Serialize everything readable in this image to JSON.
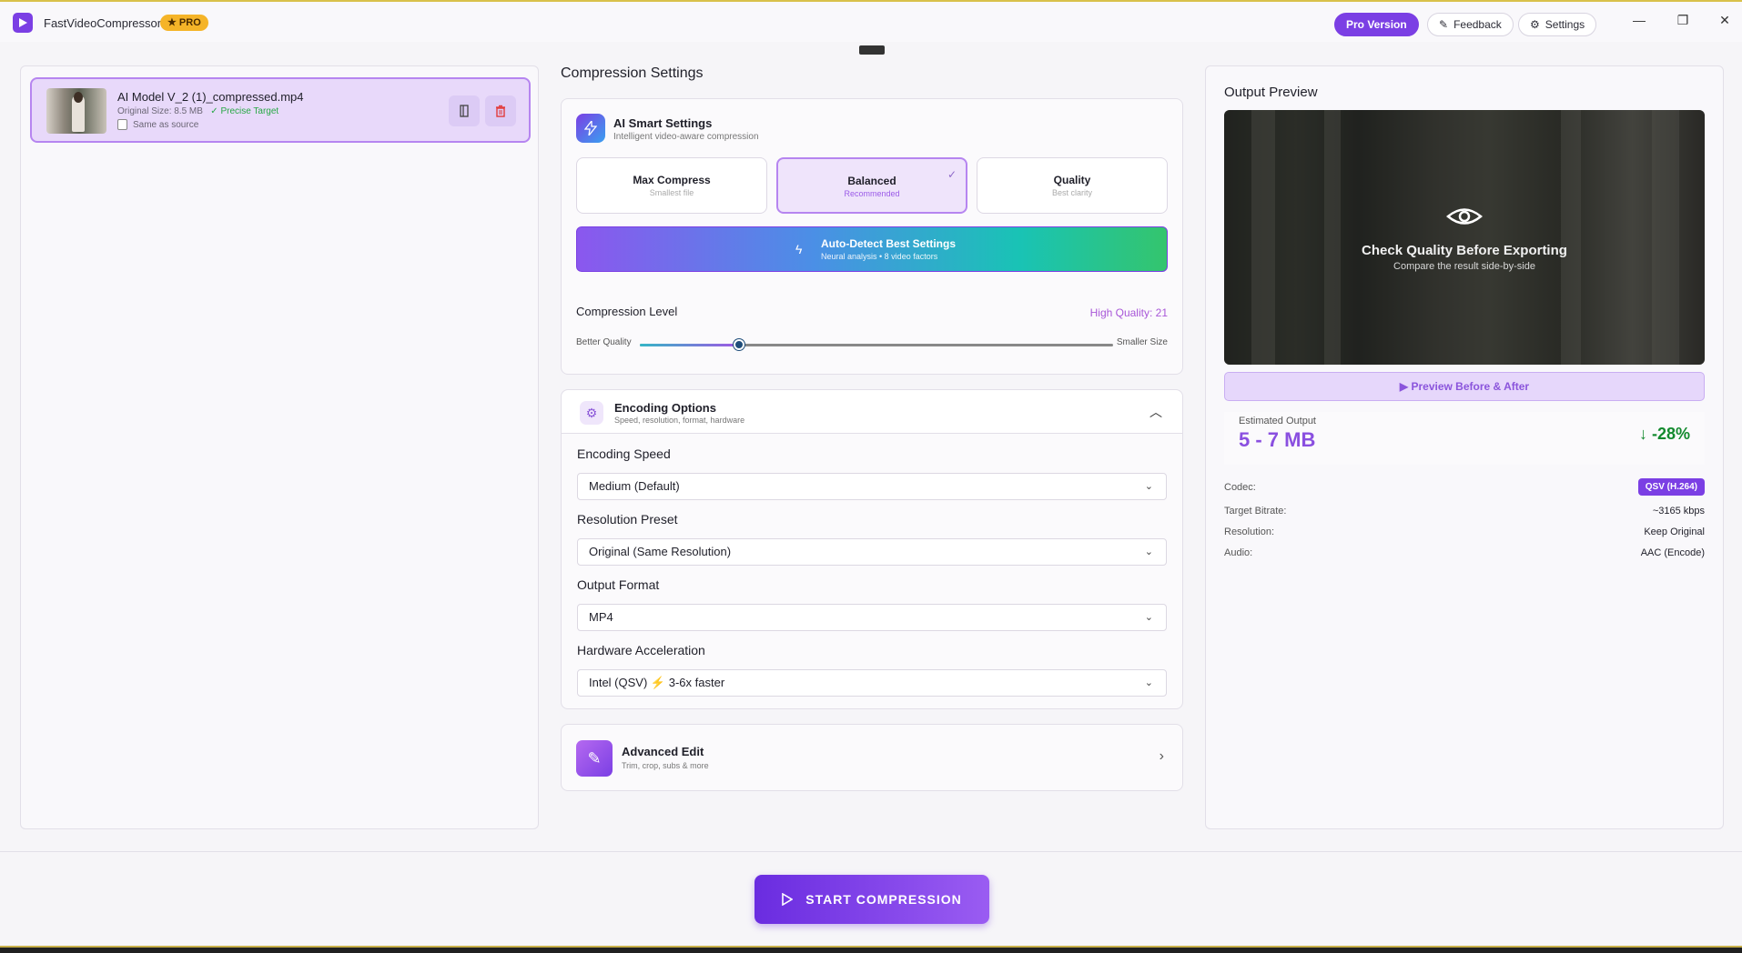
{
  "app": {
    "title": "FastVideoCompressor",
    "badge": "★ PRO"
  },
  "toolbar": {
    "pro_label": "Pro Version",
    "feedback_label": "Feedback",
    "settings_label": "Settings",
    "window_controls": [
      "—",
      "❐",
      "✕"
    ]
  },
  "file": {
    "name": "AI Model V_2 (1)_compressed.mp4",
    "size_label": "Original Size:",
    "size": "8.5 MB",
    "target": "✓ Precise Target",
    "sub": "Same as source"
  },
  "compression": {
    "title": "Compression Settings",
    "ai_title": "AI Smart Settings",
    "ai_sub": "Intelligent video-aware compression",
    "modes": [
      {
        "title": "Max Compress",
        "sub": "Smallest file"
      },
      {
        "title": "Balanced",
        "sub": "Recommended"
      },
      {
        "title": "Quality",
        "sub": "Best clarity"
      }
    ],
    "selected_mode": "Balanced",
    "auto_title": "Auto-Detect Best Settings",
    "auto_sub": "Neural analysis • 8 video factors",
    "level_label": "Compression Level",
    "level_value": "High Quality: 21",
    "slider_left": "Better Quality",
    "slider_right": "Smaller Size",
    "slider_fraction": 0.21
  },
  "encoding": {
    "title": "Encoding Options",
    "sub": "Speed, resolution, format, hardware",
    "speed_label": "Encoding Speed",
    "speed_value": "Medium (Default)",
    "resolution_label": "Resolution Preset",
    "resolution_value": "Original (Same Resolution)",
    "format_label": "Output Format",
    "format_value": "MP4",
    "hw_label": "Hardware Acceleration",
    "hw_value": "Intel (QSV)",
    "hw_bolt": "⚡",
    "hw_suffix": "3-6x faster"
  },
  "advanced": {
    "title": "Advanced Edit",
    "sub": "Trim, crop, subs & more"
  },
  "output": {
    "title": "Output Preview",
    "preview_title": "Check Quality Before Exporting",
    "preview_sub": "Compare the result side-by-side",
    "preview_btn": "▶  Preview Before & After",
    "est_label": "Estimated Output",
    "est_value": "5 - 7 MB",
    "delta": "↓ -28%",
    "codec_label": "Codec:",
    "codec_value": "QSV (H.264)",
    "bitrate_label": "Target Bitrate:",
    "bitrate_value": "~3165 kbps",
    "resolution_label": "Resolution:",
    "resolution_value": "Keep Original",
    "audio_label": "Audio:",
    "audio_value": "AAC (Encode)"
  },
  "actions": {
    "start_label": "START COMPRESSION"
  },
  "colors": {
    "accent": "#7b3fe4",
    "success": "#138a2e",
    "badge": "#f5b428"
  }
}
